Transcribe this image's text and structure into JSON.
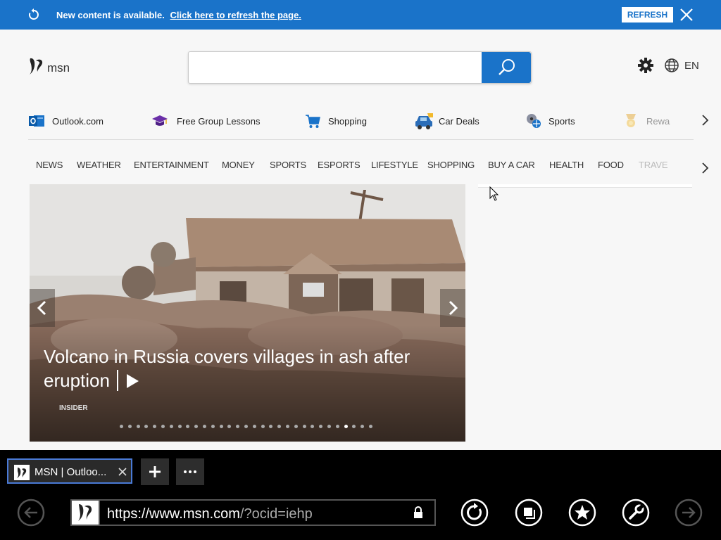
{
  "notification": {
    "message": "New content is available.",
    "link": "Click here to refresh the page.",
    "refresh_label": "REFRESH"
  },
  "header": {
    "logo_text": "msn",
    "search_value": "",
    "language": "EN"
  },
  "quick_links": [
    {
      "label": "Outlook.com",
      "icon": "outlook-icon"
    },
    {
      "label": "Free Group Lessons",
      "icon": "graduation-cap-icon"
    },
    {
      "label": "Shopping",
      "icon": "shopping-cart-icon"
    },
    {
      "label": "Car Deals",
      "icon": "car-icon"
    },
    {
      "label": "Sports",
      "icon": "sports-ball-icon"
    },
    {
      "label": "Rewa",
      "icon": "rewards-medal-icon"
    }
  ],
  "nav": [
    "NEWS",
    "WEATHER",
    "ENTERTAINMENT",
    "MONEY",
    "SPORTS",
    "ESPORTS",
    "LIFESTYLE",
    "SHOPPING",
    "BUY A CAR",
    "HEALTH",
    "FOOD",
    "TRAVE"
  ],
  "hero": {
    "headline": "Volcano in Russia covers villages in ash after eruption",
    "source": "INSIDER",
    "slide_count": 31,
    "active_slide": 27
  },
  "browser": {
    "tab_title": "MSN | Outloo...",
    "url_host": "https://www.msn.com",
    "url_path": "/?ocid=iehp"
  },
  "colors": {
    "accent": "#1a73c9",
    "tab_border": "#4a7ad6"
  }
}
